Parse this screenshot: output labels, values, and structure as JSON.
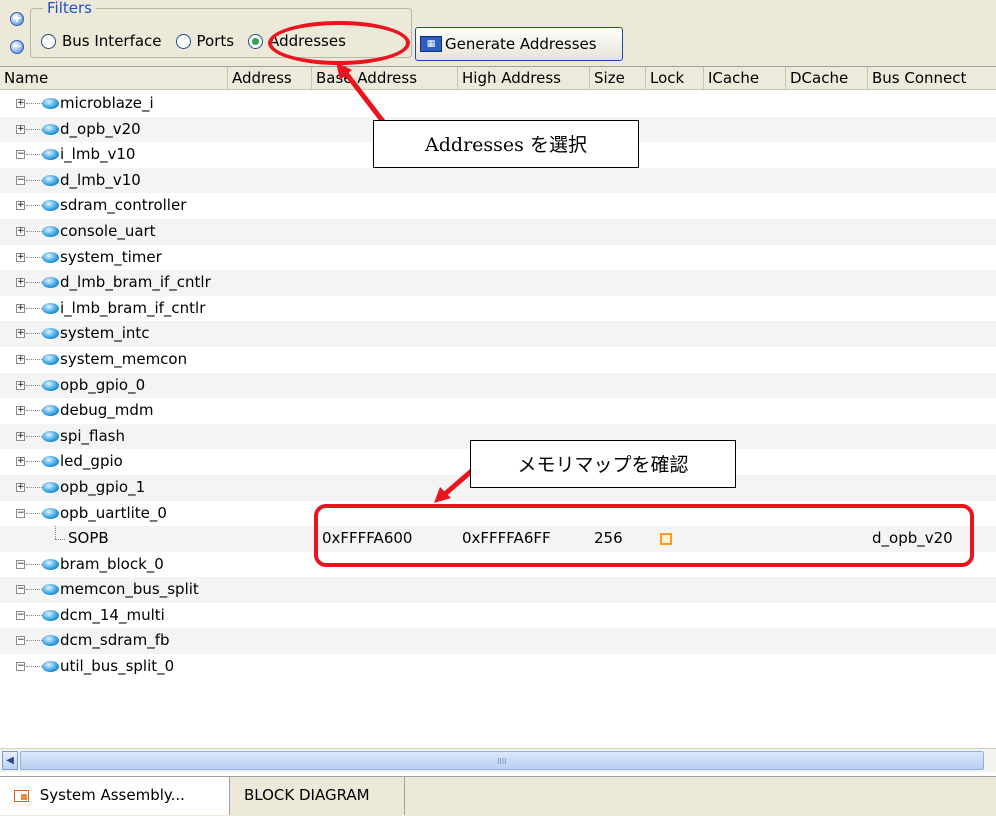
{
  "filters": {
    "legend": "Filters",
    "zoom_in": "+",
    "zoom_out": "−",
    "options": [
      {
        "label": "Bus Interface",
        "checked": false
      },
      {
        "label": "Ports",
        "checked": false
      },
      {
        "label": "Addresses",
        "checked": true
      }
    ],
    "generate_button": "Generate Addresses",
    "generate_icon": "calendar-grid-icon"
  },
  "table": {
    "columns": [
      "Name",
      "Address",
      "Base Address",
      "High Address",
      "Size",
      "Lock",
      "ICache",
      "DCache",
      "Bus Connect"
    ],
    "rows": [
      {
        "name": "microblaze_i",
        "expander": "+"
      },
      {
        "name": "d_opb_v20",
        "expander": "+"
      },
      {
        "name": "i_lmb_v10",
        "expander": "−"
      },
      {
        "name": "d_lmb_v10",
        "expander": "−"
      },
      {
        "name": "sdram_controller",
        "expander": "+"
      },
      {
        "name": "console_uart",
        "expander": "+"
      },
      {
        "name": "system_timer",
        "expander": "+"
      },
      {
        "name": "d_lmb_bram_if_cntlr",
        "expander": "+"
      },
      {
        "name": "i_lmb_bram_if_cntlr",
        "expander": "+"
      },
      {
        "name": "system_intc",
        "expander": "+"
      },
      {
        "name": "system_memcon",
        "expander": "+"
      },
      {
        "name": "opb_gpio_0",
        "expander": "+"
      },
      {
        "name": "debug_mdm",
        "expander": "+"
      },
      {
        "name": "spi_flash",
        "expander": "+"
      },
      {
        "name": "led_gpio",
        "expander": "+"
      },
      {
        "name": "opb_gpio_1",
        "expander": "+"
      },
      {
        "name": "opb_uartlite_0",
        "expander": "−"
      },
      {
        "name": "SOPB",
        "child": true,
        "base": "0xFFFFA600",
        "high": "0xFFFFA6FF",
        "size": "256",
        "bus": "d_opb_v20"
      },
      {
        "name": "bram_block_0",
        "expander": "−"
      },
      {
        "name": "memcon_bus_split",
        "expander": "−"
      },
      {
        "name": "dcm_14_multi",
        "expander": "−"
      },
      {
        "name": "dcm_sdram_fb",
        "expander": "−"
      },
      {
        "name": "util_bus_split_0",
        "expander": "−"
      }
    ]
  },
  "annotations": {
    "select_addresses": "Addresses を選択",
    "check_memory_map": "メモリマップを確認",
    "color": "#e8151f"
  },
  "scrollbar": {
    "grip": "IIII"
  },
  "tabs": [
    {
      "label": "System Assembly...",
      "active": true
    },
    {
      "label": "BLOCK DIAGRAM",
      "active": false
    }
  ]
}
